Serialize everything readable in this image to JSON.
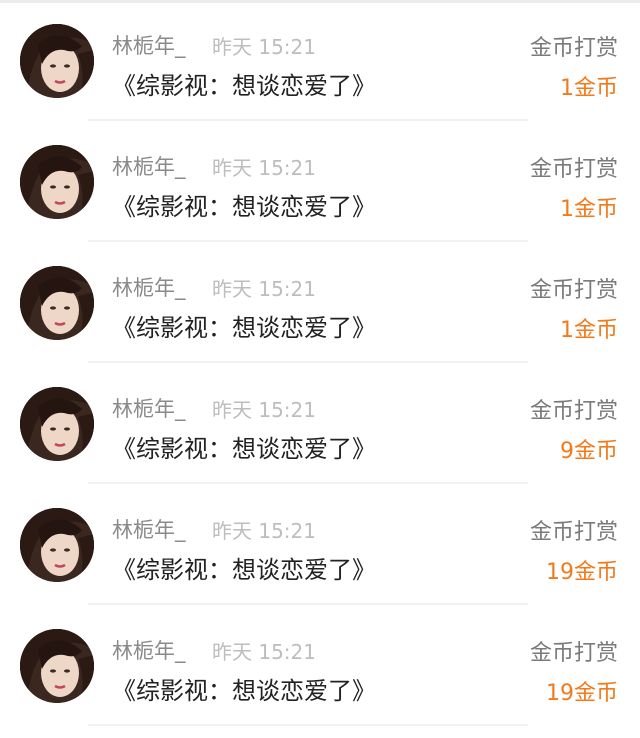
{
  "colors": {
    "name": "#8a8a8a",
    "time": "#bdbdbd",
    "title": "#222222",
    "type": "#7a7a7a",
    "amount": "#f27a1a",
    "divider": "#f1f1f1"
  },
  "rewards": [
    {
      "avatar_icon": "user-avatar-icon",
      "name": "林栀年_",
      "time": "昨天 15:21",
      "title": "《综影视：想谈恋爱了》",
      "type": "金币打赏",
      "amount": "1金币"
    },
    {
      "avatar_icon": "user-avatar-icon",
      "name": "林栀年_",
      "time": "昨天 15:21",
      "title": "《综影视：想谈恋爱了》",
      "type": "金币打赏",
      "amount": "1金币"
    },
    {
      "avatar_icon": "user-avatar-icon",
      "name": "林栀年_",
      "time": "昨天 15:21",
      "title": "《综影视：想谈恋爱了》",
      "type": "金币打赏",
      "amount": "1金币"
    },
    {
      "avatar_icon": "user-avatar-icon",
      "name": "林栀年_",
      "time": "昨天 15:21",
      "title": "《综影视：想谈恋爱了》",
      "type": "金币打赏",
      "amount": "9金币"
    },
    {
      "avatar_icon": "user-avatar-icon",
      "name": "林栀年_",
      "time": "昨天 15:21",
      "title": "《综影视：想谈恋爱了》",
      "type": "金币打赏",
      "amount": "19金币"
    },
    {
      "avatar_icon": "user-avatar-icon",
      "name": "林栀年_",
      "time": "昨天 15:21",
      "title": "《综影视：想谈恋爱了》",
      "type": "金币打赏",
      "amount": "19金币"
    }
  ]
}
